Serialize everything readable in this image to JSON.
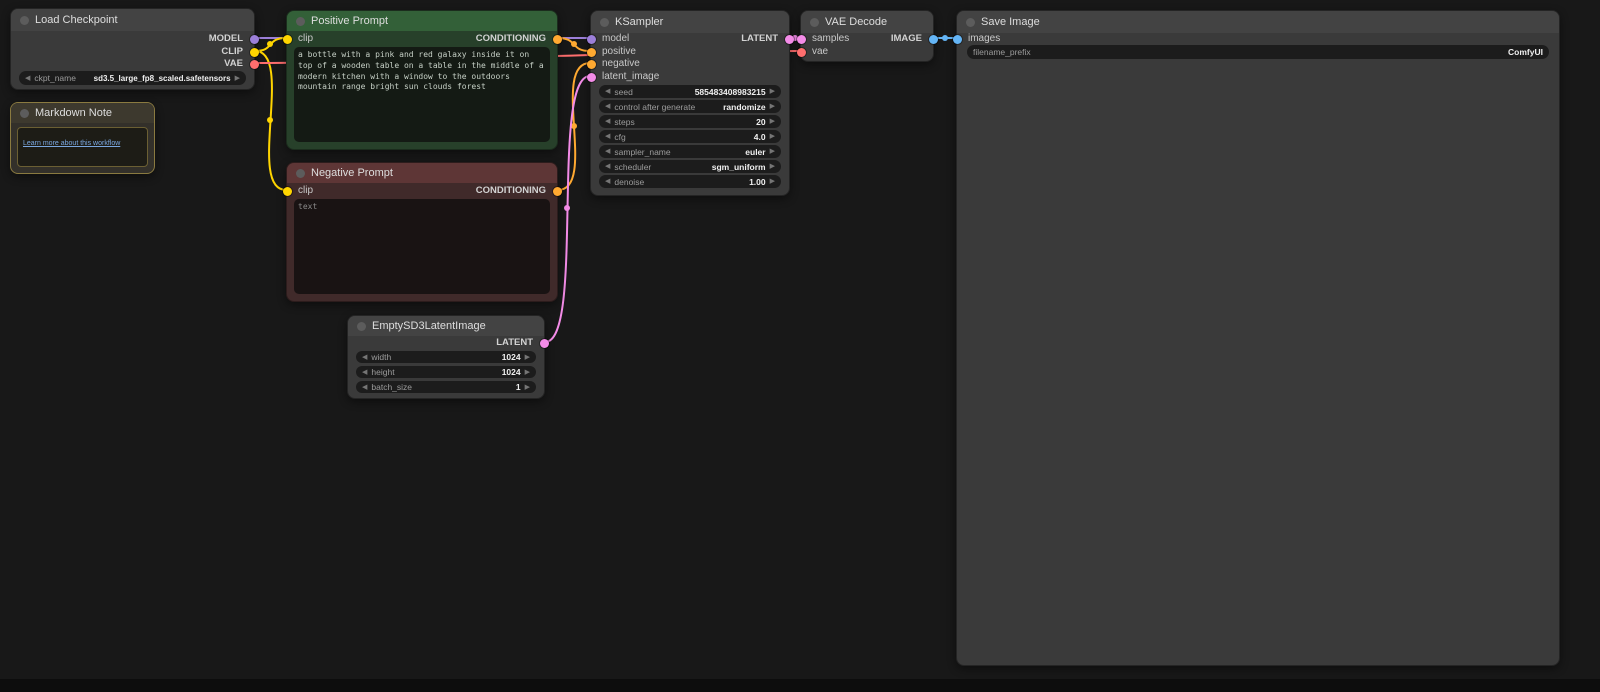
{
  "canvas": {
    "background": "#181818"
  },
  "icons": {
    "arrow_left": "◀",
    "arrow_right": "▶"
  },
  "port_colors": {
    "MODEL": "#9C7FD9",
    "CLIP": "#FFD500",
    "VAE": "#FF6E6E",
    "CONDITIONING": "#FFA931",
    "LATENT": "#F48CE8",
    "IMAGE": "#64B5F6"
  },
  "nodes": {
    "load_checkpoint": {
      "title": "Load Checkpoint",
      "outputs": [
        {
          "name": "MODEL"
        },
        {
          "name": "CLIP"
        },
        {
          "name": "VAE"
        }
      ],
      "widgets": [
        {
          "label": "ckpt_name",
          "value": "sd3.5_large_fp8_scaled.safetensors"
        }
      ]
    },
    "markdown_note": {
      "title": "Markdown Note",
      "link": "Learn more about this workflow"
    },
    "positive_prompt": {
      "title": "Positive Prompt",
      "input": "clip",
      "output": "CONDITIONING",
      "text": "a bottle with a pink and red galaxy inside it on top of a wooden table on a table in the middle of a modern kitchen with a window to the outdoors mountain range bright sun clouds forest"
    },
    "negative_prompt": {
      "title": "Negative Prompt",
      "input": "clip",
      "output": "CONDITIONING",
      "placeholder": "text"
    },
    "empty_latent": {
      "title": "EmptySD3LatentImage",
      "output": "LATENT",
      "widgets": [
        {
          "label": "width",
          "value": "1024"
        },
        {
          "label": "height",
          "value": "1024"
        },
        {
          "label": "batch_size",
          "value": "1"
        }
      ]
    },
    "ksampler": {
      "title": "KSampler",
      "inputs": [
        "model",
        "positive",
        "negative",
        "latent_image"
      ],
      "output": "LATENT",
      "widgets": [
        {
          "label": "seed",
          "value": "585483408983215"
        },
        {
          "label": "control after generate",
          "value": "randomize"
        },
        {
          "label": "steps",
          "value": "20"
        },
        {
          "label": "cfg",
          "value": "4.0"
        },
        {
          "label": "sampler_name",
          "value": "euler"
        },
        {
          "label": "scheduler",
          "value": "sgm_uniform"
        },
        {
          "label": "denoise",
          "value": "1.00"
        }
      ]
    },
    "vae_decode": {
      "title": "VAE Decode",
      "inputs": [
        "samples",
        "vae"
      ],
      "output": "IMAGE"
    },
    "save_image": {
      "title": "Save Image",
      "input": "images",
      "widgets": [
        {
          "label": "filename_prefix",
          "value": "ComfyUI"
        }
      ]
    }
  },
  "links": [
    {
      "from": "Load Checkpoint.MODEL",
      "to": "KSampler.model",
      "color": "#9C7FD9"
    },
    {
      "from": "Load Checkpoint.CLIP",
      "to": "Positive Prompt.clip",
      "color": "#FFD500"
    },
    {
      "from": "Load Checkpoint.CLIP",
      "to": "Negative Prompt.clip",
      "color": "#FFD500"
    },
    {
      "from": "Load Checkpoint.VAE",
      "to": "VAE Decode.vae",
      "color": "#FF6E6E"
    },
    {
      "from": "Positive Prompt.CONDITIONING",
      "to": "KSampler.positive",
      "color": "#FFA931"
    },
    {
      "from": "Negative Prompt.CONDITIONING",
      "to": "KSampler.negative",
      "color": "#FFA931"
    },
    {
      "from": "EmptySD3LatentImage.LATENT",
      "to": "KSampler.latent_image",
      "color": "#F48CE8"
    },
    {
      "from": "KSampler.LATENT",
      "to": "VAE Decode.samples",
      "color": "#F48CE8"
    },
    {
      "from": "VAE Decode.IMAGE",
      "to": "Save Image.images",
      "color": "#64B5F6"
    }
  ]
}
